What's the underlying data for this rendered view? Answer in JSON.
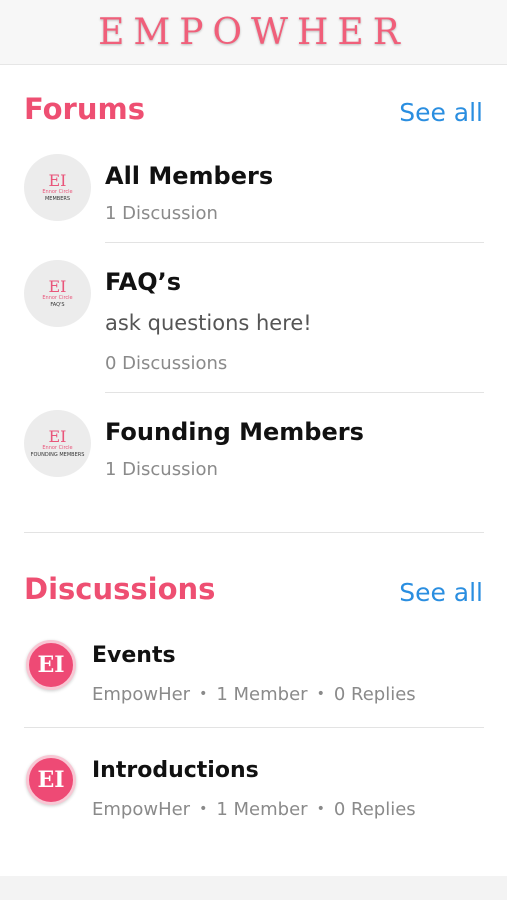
{
  "header": {
    "brand": "EMPOWHER"
  },
  "forums": {
    "title": "Forums",
    "see_all": "See all",
    "items": [
      {
        "title": "All Members",
        "description": "",
        "count": "1 Discussion",
        "avatar_mono": "EI",
        "avatar_line1": "Ennor Circle",
        "avatar_line2": "MEMBERS"
      },
      {
        "title": "FAQ’s",
        "description": "ask questions here!",
        "count": "0 Discussions",
        "avatar_mono": "EI",
        "avatar_line1": "Ennor Circle",
        "avatar_line2": "FAQ'S"
      },
      {
        "title": "Founding Members",
        "description": "",
        "count": "1 Discussion",
        "avatar_mono": "EI",
        "avatar_line1": "Ennor Circle",
        "avatar_line2": "FOUNDING MEMBERS"
      }
    ]
  },
  "discussions": {
    "title": "Discussions",
    "see_all": "See all",
    "items": [
      {
        "title": "Events",
        "author": "EmpowHer",
        "members": "1 Member",
        "replies": "0 Replies",
        "avatar_mono": "EI"
      },
      {
        "title": "Introductions",
        "author": "EmpowHer",
        "members": "1 Member",
        "replies": "0 Replies",
        "avatar_mono": "EI"
      }
    ]
  },
  "colors": {
    "accent": "#ee4f72",
    "link": "#2a8ee0",
    "brand": "#f05f7a"
  }
}
